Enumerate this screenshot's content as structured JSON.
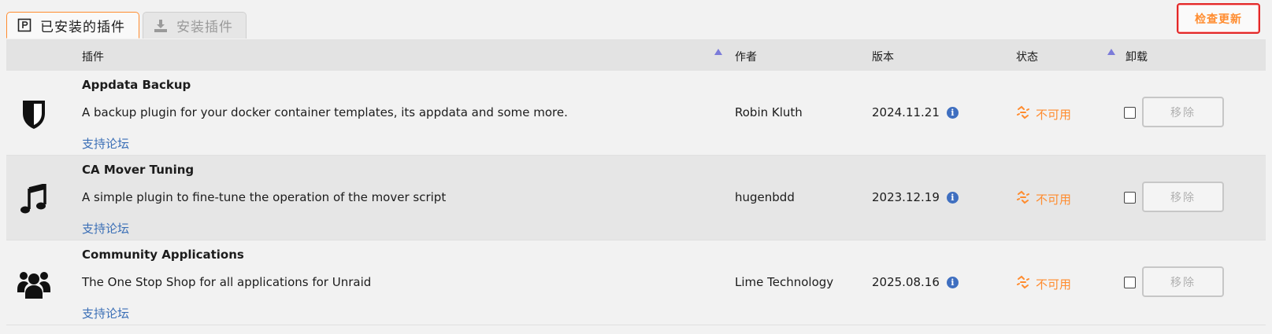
{
  "tabs": [
    {
      "label": "已安装的插件",
      "icon": "installed-plugins-icon",
      "active": true
    },
    {
      "label": "安装插件",
      "icon": "download-icon",
      "active": false
    }
  ],
  "check_updates_label": "检查更新",
  "columns": {
    "plugin": "插件",
    "author": "作者",
    "version": "版本",
    "status": "状态",
    "uninstall": "卸载"
  },
  "plugins": [
    {
      "name": "Appdata Backup",
      "description": "A backup plugin for your docker container templates, its appdata and some more.",
      "forum": "支持论坛",
      "author": "Robin Kluth",
      "version": "2024.11.21",
      "status": "不可用",
      "remove": "移除",
      "icon": "shield-icon"
    },
    {
      "name": "CA Mover Tuning",
      "description": "A simple plugin to fine-tune the operation of the mover script",
      "forum": "支持论坛",
      "author": "hugenbdd",
      "version": "2023.12.19",
      "status": "不可用",
      "remove": "移除",
      "icon": "music-note-icon"
    },
    {
      "name": "Community Applications",
      "description": "The One Stop Shop for all applications for Unraid",
      "forum": "支持论坛",
      "author": "Lime Technology",
      "version": "2025.08.16",
      "status": "不可用",
      "remove": "移除",
      "icon": "users-icon"
    }
  ],
  "colors": {
    "accent": "#ff8c2f",
    "link": "#3b6fb6",
    "danger_border": "#e22828"
  }
}
